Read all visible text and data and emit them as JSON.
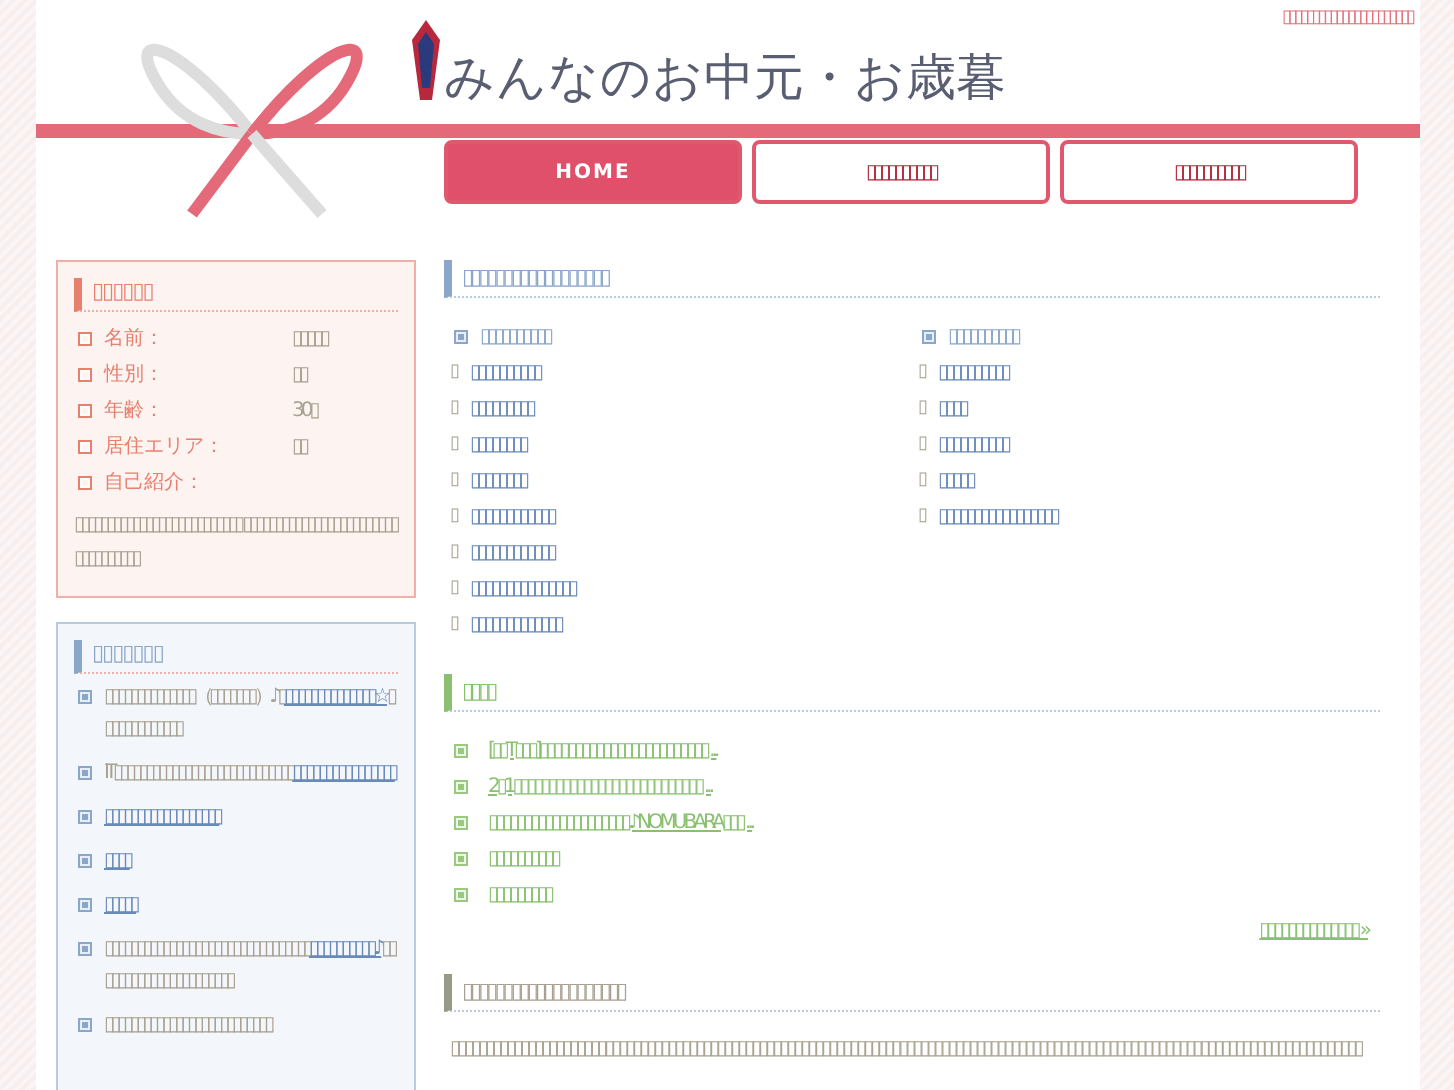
{
  "header": {
    "top_link": "▯▯▯▯▯▯▯▯▯▯▯▯▯▯▯▯▯▯▯▯▯▯",
    "logo_title": "みんなのお中元・お歳暮"
  },
  "nav": [
    {
      "label": "HOME",
      "selected": true
    },
    {
      "label": "▯▯▯▯▯▯▯▯▯▯",
      "selected": false
    },
    {
      "label": "▯▯▯▯▯▯▯▯▯▯",
      "selected": false
    }
  ],
  "profile": {
    "title": "▯▯▯▯▯▯",
    "fields": [
      {
        "label": "名前：",
        "value": "▯▯▯▯▯"
      },
      {
        "label": "性別：",
        "value": "▯▯"
      },
      {
        "label": "年齢：",
        "value": "30▯"
      },
      {
        "label": "居住エリア：",
        "value": "▯▯"
      }
    ],
    "intro_label": "自己紹介：",
    "intro": "▯▯▯▯▯▯▯▯▯▯▯▯▯▯▯▯▯▯▯▯▯▯▯▯▯▯ ▯▯▯▯▯▯▯▯▯▯▯▯▯▯▯▯▯▯▯▯▯▯▯▯▯▯▯▯▯▯▯▯▯▯"
  },
  "sidebar_list": {
    "title": "▯▯▯▯▯▯▯",
    "items": [
      {
        "parts": [
          {
            "text": "▯▯▯▯▯▯▯▯▯▯▯▯▯▯（▯▯▯▯▯▯▯）♪▯",
            "link": false
          },
          {
            "text": "▯▯▯▯▯▯▯▯▯▯▯▯▯▯☆",
            "link": true
          },
          {
            "text": "▯▯▯▯▯▯▯▯▯▯▯▯▯",
            "link": false
          }
        ]
      },
      {
        "parts": [
          {
            "text": "IT▯▯▯▯▯▯▯▯▯▯▯▯▯▯▯▯▯▯▯▯▯▯▯▯▯▯▯▯",
            "link": false
          },
          {
            "text": "▯▯▯▯▯▯▯▯▯▯▯▯▯▯▯▯",
            "link": true
          }
        ]
      },
      {
        "parts": [
          {
            "text": "▯▯▯▯▯▯▯▯▯▯▯▯▯▯▯▯▯▯",
            "link": true
          }
        ]
      },
      {
        "parts": [
          {
            "text": "▯▯▯▯",
            "link": true
          }
        ]
      },
      {
        "parts": [
          {
            "text": "▯▯▯▯▯",
            "link": true
          }
        ]
      },
      {
        "parts": [
          {
            "text": "▯▯▯▯▯▯▯▯▯▯▯▯▯▯▯▯▯▯▯▯▯▯▯▯▯▯▯▯▯▯▯▯",
            "link": false
          },
          {
            "text": "▯▯▯▯▯▯▯▯▯▯♪",
            "link": true
          },
          {
            "text": "▯▯▯▯▯▯▯▯▯▯▯▯▯▯▯▯▯▯▯▯▯▯",
            "link": false
          }
        ]
      },
      {
        "parts": [
          {
            "text": "▯▯▯▯▯▯▯▯▯▯▯▯▯▯▯▯▯▯▯▯▯▯▯▯▯▯",
            "link": false
          }
        ]
      }
    ]
  },
  "categories": {
    "title": "▯▯▯▯▯▯▯▯▯▯▯▯▯▯▯▯▯▯",
    "columns": [
      {
        "heading": "▯▯▯▯▯▯▯▯▯▯",
        "links": [
          {
            "marker": "▯",
            "label": "▯▯▯▯▯▯▯▯▯▯"
          },
          {
            "marker": "▯",
            "label": "▯▯▯▯▯▯▯▯▯"
          },
          {
            "marker": "▯",
            "label": "▯▯▯▯▯▯▯▯"
          },
          {
            "marker": "▯",
            "label": "▯▯▯▯▯▯▯▯"
          },
          {
            "marker": "▯",
            "label": "▯▯▯▯▯▯▯▯▯▯▯▯"
          },
          {
            "marker": "▯",
            "label": "▯▯▯▯▯▯▯▯▯▯▯▯"
          },
          {
            "marker": "▯",
            "label": "▯▯▯▯▯▯▯▯▯▯▯▯▯▯▯"
          },
          {
            "marker": "▯",
            "label": "▯▯▯▯▯▯▯▯▯▯▯▯▯"
          }
        ]
      },
      {
        "heading": "▯▯▯▯▯▯▯▯▯▯",
        "links": [
          {
            "marker": "▯",
            "label": "▯▯▯▯▯▯▯▯▯▯"
          },
          {
            "marker": "▯",
            "label": "▯▯▯▯"
          },
          {
            "marker": "▯",
            "label": "▯▯▯▯▯▯▯▯▯▯"
          },
          {
            "marker": "▯",
            "label": "▯▯▯▯▯"
          },
          {
            "marker": "▯",
            "label": "▯▯▯▯▯▯▯▯▯▯▯▯▯▯▯▯▯"
          }
        ]
      }
    ]
  },
  "news": {
    "title": "▯▯▯▯",
    "items": [
      "[▯▯T▯▯▯]▯▯▯▯▯▯▯▯▯▯▯▯▯▯▯▯▯▯▯▯▯▯▯▯ ...",
      "2▯1▯▯▯▯▯▯▯▯▯▯▯▯▯▯▯▯▯▯▯▯▯▯▯▯▯▯▯ ...",
      "▯▯▯▯▯▯▯▯▯▯▯▯▯▯▯▯▯▯▯▯♪NOMUBARA▯▯▯ ...",
      "▯▯▯▯▯▯▯▯▯▯",
      "▯▯▯▯▯▯▯▯▯"
    ],
    "more": "▯▯▯▯▯▯▯▯▯▯▯▯▯▯ »"
  },
  "about": {
    "title": "▯▯▯▯▯▯▯▯▯▯▯▯▯▯▯▯▯▯▯▯",
    "text": "▯▯▯▯▯▯▯▯▯▯▯▯▯▯▯▯▯▯▯▯▯▯▯▯▯▯▯▯▯▯▯▯▯▯▯▯▯▯▯▯▯▯▯▯▯▯▯▯▯▯▯▯▯▯▯▯▯▯▯▯▯▯▯▯▯▯▯▯▯▯▯▯▯▯▯▯▯▯▯▯▯▯▯▯▯▯▯▯▯▯▯▯▯▯▯▯▯▯▯▯▯▯▯▯▯▯▯▯▯▯▯▯▯▯▯▯▯▯▯▯▯▯▯▯▯▯▯▯▯▯"
  }
}
